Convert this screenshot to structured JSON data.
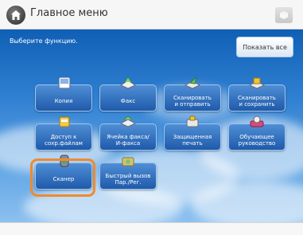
{
  "header": {
    "title": "Главное меню"
  },
  "subtitle": "Выберите функцию.",
  "show_all_label": "Показать все",
  "functions": [
    {
      "label": "Копия",
      "icon": "copy-icon"
    },
    {
      "label": "Факс",
      "icon": "fax-icon"
    },
    {
      "label": "Сканировать\nи отправить",
      "icon": "scan-send-icon"
    },
    {
      "label": "Сканировать\nи сохранить",
      "icon": "scan-save-icon"
    },
    {
      "label": "Доступ к\nсохр.файлам",
      "icon": "stored-files-icon"
    },
    {
      "label": "Ячейка факса/\nИ-факса",
      "icon": "fax-inbox-icon"
    },
    {
      "label": "Защищенная\nпечать",
      "icon": "secure-print-icon"
    },
    {
      "label": "Обучающее\nруководство",
      "icon": "tutorial-icon"
    },
    {
      "label": "Сканер",
      "icon": "scanner-icon"
    },
    {
      "label": "Быстрый вызов\nПар./Рег.",
      "icon": "quick-recall-icon"
    }
  ],
  "highlighted_function": "Сканер",
  "colors": {
    "highlight": "#f08a2e",
    "button": "#2f6fc0",
    "sky": "#2f7fd2"
  }
}
